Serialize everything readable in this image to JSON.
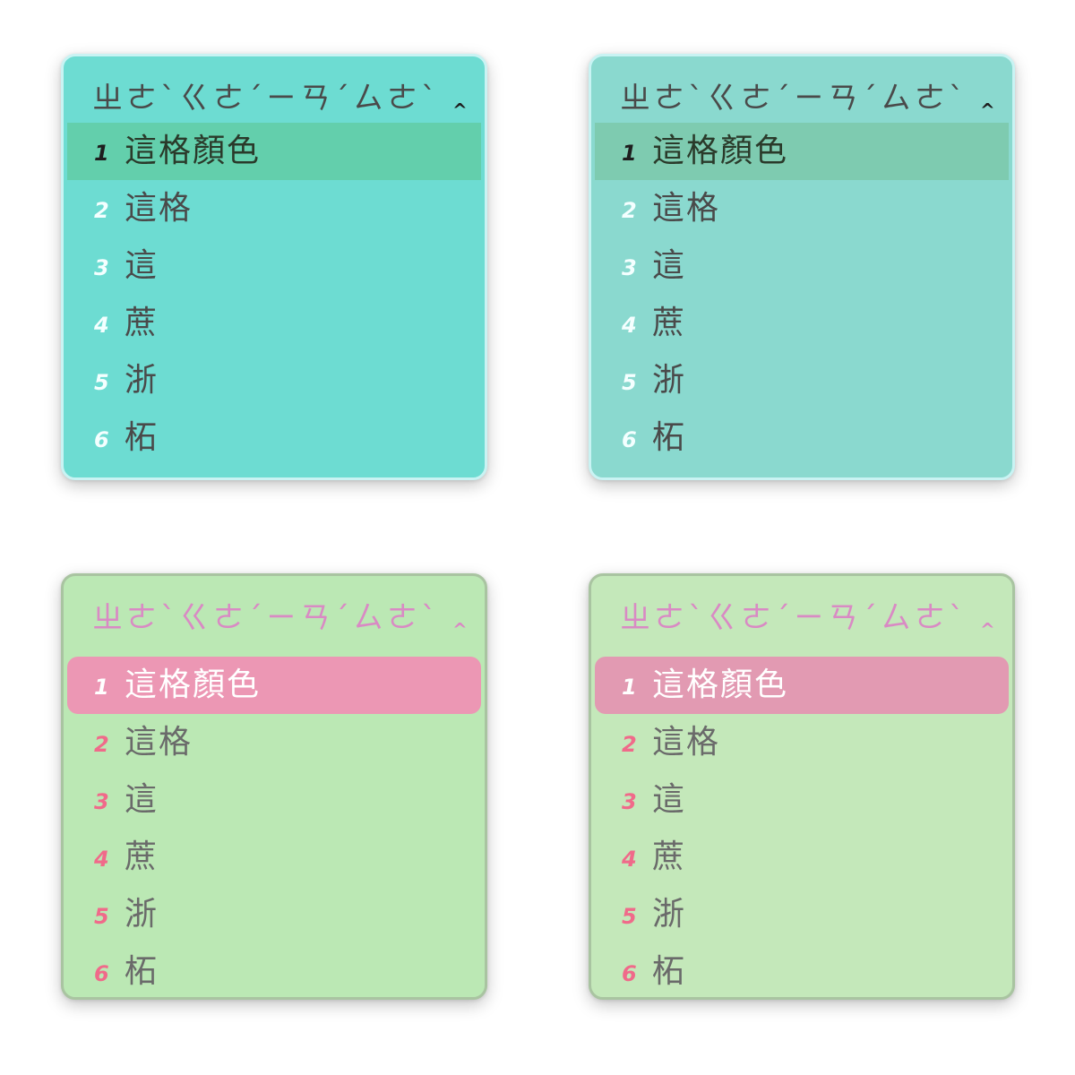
{
  "panels": [
    {
      "theme": {
        "background": "#6ddcd2",
        "border": "#c9f3f3",
        "preedit_color": "#4a4a4a",
        "highlight_bg": "#63cfac",
        "highlight_text": "#2a3a2a",
        "highlight_index": "#1e1e1e",
        "index_color": "#f4ffff",
        "text_color": "#4a4a4a"
      },
      "preedit": "ㄓㄜˋㄍㄜˊㄧㄢˊㄙㄜˋ",
      "caret": "^",
      "candidates": [
        {
          "index": "1",
          "text": "這格顏色"
        },
        {
          "index": "2",
          "text": "這格"
        },
        {
          "index": "3",
          "text": "這"
        },
        {
          "index": "4",
          "text": "蔗"
        },
        {
          "index": "5",
          "text": "浙"
        },
        {
          "index": "6",
          "text": "柘"
        }
      ]
    },
    {
      "theme": {
        "background": "#8ad9cf",
        "border": "#c9f3f3",
        "preedit_color": "#4a4a4a",
        "highlight_bg": "#7ecbb0",
        "highlight_text": "#2a3a2a",
        "highlight_index": "#1e1e1e",
        "index_color": "#f4ffff",
        "text_color": "#4a4a4a"
      },
      "preedit": "ㄓㄜˋㄍㄜˊㄧㄢˊㄙㄜˋ",
      "caret": "^",
      "candidates": [
        {
          "index": "1",
          "text": "這格顏色"
        },
        {
          "index": "2",
          "text": "這格"
        },
        {
          "index": "3",
          "text": "這"
        },
        {
          "index": "4",
          "text": "蔗"
        },
        {
          "index": "5",
          "text": "浙"
        },
        {
          "index": "6",
          "text": "柘"
        }
      ]
    },
    {
      "theme": {
        "background": "#bbe8b4",
        "border": "#a9c4a1",
        "preedit_color": "#d98ac4",
        "highlight_bg": "#ec97b4",
        "highlight_text": "#ffffff",
        "highlight_index": "#ffffff",
        "index_color": "#f06a8a",
        "text_color": "#6a6a6a"
      },
      "preedit": "ㄓㄜˋㄍㄜˊㄧㄢˊㄙㄜˋ",
      "caret": "^",
      "candidates": [
        {
          "index": "1",
          "text": "這格顏色"
        },
        {
          "index": "2",
          "text": "這格"
        },
        {
          "index": "3",
          "text": "這"
        },
        {
          "index": "4",
          "text": "蔗"
        },
        {
          "index": "5",
          "text": "浙"
        },
        {
          "index": "6",
          "text": "柘"
        }
      ]
    },
    {
      "theme": {
        "background": "#c4e8ba",
        "border": "#a9c4a1",
        "preedit_color": "#d98ac4",
        "highlight_bg": "#e29ab2",
        "highlight_text": "#ffffff",
        "highlight_index": "#ffffff",
        "index_color": "#f06a8a",
        "text_color": "#6a6a6a"
      },
      "preedit": "ㄓㄜˋㄍㄜˊㄧㄢˊㄙㄜˋ",
      "caret": "^",
      "candidates": [
        {
          "index": "1",
          "text": "這格顏色"
        },
        {
          "index": "2",
          "text": "這格"
        },
        {
          "index": "3",
          "text": "這"
        },
        {
          "index": "4",
          "text": "蔗"
        },
        {
          "index": "5",
          "text": "浙"
        },
        {
          "index": "6",
          "text": "柘"
        }
      ]
    }
  ]
}
